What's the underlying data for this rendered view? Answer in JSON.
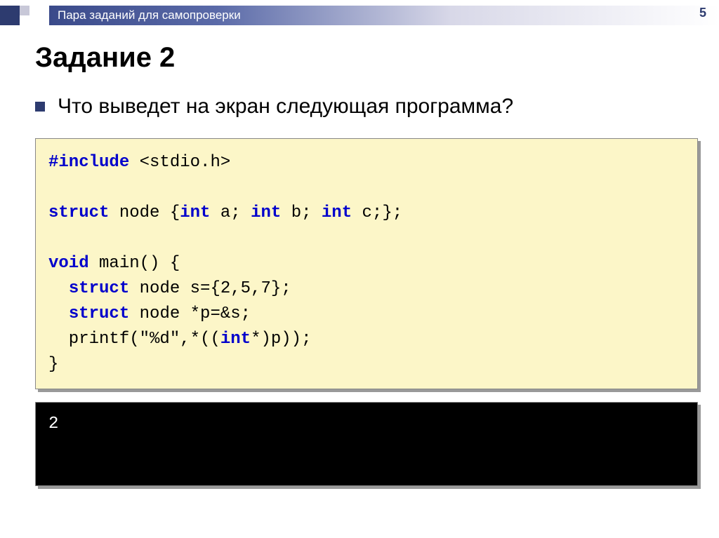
{
  "page_number": "5",
  "header": {
    "title": "Пара заданий для самопроверки"
  },
  "main": {
    "heading": "Задание 2",
    "question": "Что выведет на экран следующая программа?",
    "code": {
      "k_include": "#include",
      "t_include_rest": " <stdio.h>",
      "k_struct1": "struct",
      "t_struct1_rest": " node {",
      "k_int1": "int",
      "t_int1_rest": " a; ",
      "k_int2": "int",
      "t_int2_rest": " b; ",
      "k_int3": "int",
      "t_int3_rest": " c;};",
      "k_void": "void",
      "t_void_rest": " main() {",
      "indent": "  ",
      "k_struct2": "struct",
      "t_struct2_rest": " node s={2,5,7};",
      "k_struct3": "struct",
      "t_struct3_rest": " node *p=&s;",
      "t_printf": "  printf(\"%d\",*((",
      "k_int4": "int",
      "t_printf_rest": "*)p));",
      "t_close": "}"
    },
    "output": "2"
  }
}
